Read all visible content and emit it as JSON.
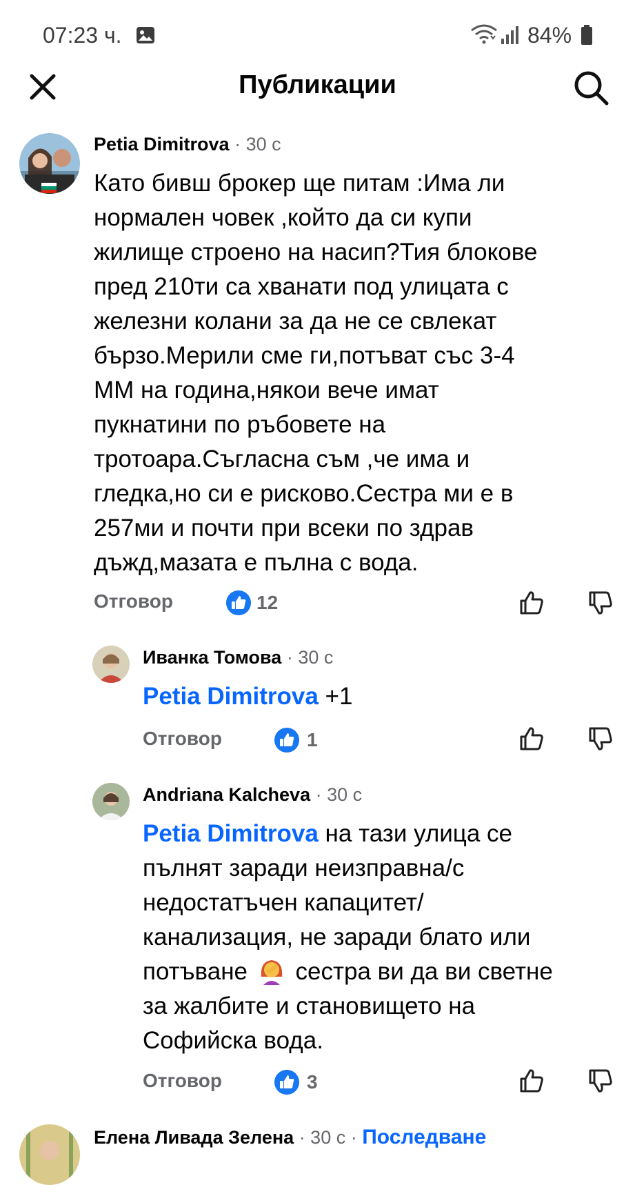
{
  "status_bar": {
    "time": "07:23 ч.",
    "battery": "84%"
  },
  "header": {
    "title": "Публикации"
  },
  "comments": [
    {
      "author": "Petia Dimitrova",
      "time": "· 30 с",
      "text_lines": [
        "Като бивш брокер ще питам :Има ли",
        "нормален човек ,който да си купи",
        "жилище строено на насип?Тия блокове",
        "пред 210ти са хванати под улицата с",
        "железни колани за да не се свлекат",
        "бързо.Мерили сме ги,потъват със 3-4",
        "ММ на година,някои вече имат",
        "пукнатини по ръбовете на",
        "тротоара.Съгласна съм ,че има и",
        "гледка,но си е рисково.Сестра ми е в",
        "257ми и почти при всеки по здрав",
        "дъжд,мазата е пълна с вода."
      ],
      "reply_label": "Отговор",
      "likes": "12"
    },
    {
      "author": "Иванка Томова",
      "time": "· 30 с",
      "mention": "Petia Dimitrova",
      "text_after_mention": "+1",
      "reply_label": "Отговор",
      "likes": "1"
    },
    {
      "author": "Andriana Kalcheva",
      "time": "· 30 с",
      "mention": "Petia Dimitrova",
      "first_line_rest": "на тази улица се",
      "text_lines": [
        "пълнят заради неизправна/с",
        "недостатъчен капацитет/",
        "канализация, не заради блато или"
      ],
      "line_before_emoji": "потъване",
      "emoji": "facepalm-woman-emoji",
      "line_after_emoji": "сестра ви да ви светне",
      "text_lines_end": [
        "за жалбите и становището на",
        "Софийска вода."
      ],
      "reply_label": "Отговор",
      "likes": "3"
    },
    {
      "author": "Елена Ливада Зелена",
      "time": "· 30 с ·",
      "follow_label": "Последване"
    }
  ],
  "icons": {
    "close": "close-icon",
    "search": "search-icon",
    "like": "like-badge-icon",
    "thumb_up": "thumb-up-icon",
    "thumb_down": "thumb-down-icon"
  },
  "colors": {
    "accent": "#0866ff",
    "like_badge": "#1877f2",
    "meta": "#65676b",
    "text": "#050505"
  }
}
